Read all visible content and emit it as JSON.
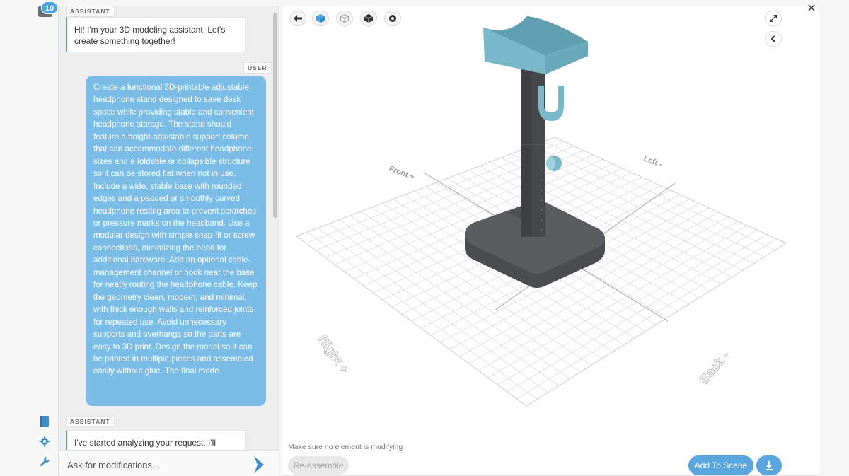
{
  "rail": {
    "badge_count": "10",
    "icons": [
      "chat-icon",
      "book-icon",
      "gear-icon",
      "wrench-icon"
    ]
  },
  "chat": {
    "messages": [
      {
        "role": "ASSISTANT",
        "text": "Hi! I'm your 3D modeling assistant. Let's create something together!"
      },
      {
        "role": "USER",
        "text": "Create a functional 3D-printable adjustable headphone stand designed to save desk space while providing stable and convenient headphone storage. The stand should feature a height-adjustable support column that can accommodate different headphone sizes and a foldable or collapsible structure so it can be stored flat when not in use. Include a wide, stable base with rounded edges and a padded or smoothly curved headphone resting area to prevent scratches or pressure marks on the headband. Use a modular design with simple snap-fit or screw connections, minimizing the need for additional hardware. Add an optional cable-management channel or hook near the base for neatly routing the headphone cable. Keep the geometry clean, modern, and minimal, with thick enough walls and reinforced joints for repeated use. Avoid unnecessary supports and overhangs so the parts are easy to 3D print. Design the model so it can be printed in multiple pieces and assembled easily without glue. The final mode"
      },
      {
        "role": "ASSISTANT",
        "text": "I've started analyzing your request. I'll follow"
      }
    ],
    "input_placeholder": "Ask for modifications..."
  },
  "viewer": {
    "toolbar": [
      "back-arrow-icon",
      "cube-solid-icon",
      "cube-wireframe-icon",
      "cube-shaded-icon",
      "gear-cube-icon"
    ],
    "axis_labels": {
      "front": "Front +",
      "left": "Left -",
      "right": "Right +",
      "back": "Back -"
    },
    "status_hint": "Make sure no element is modifying",
    "reassemble_label": "Re-assemble",
    "add_to_scene_label": "Add To Scene",
    "colors": {
      "accent": "#5aa7e0",
      "model_teal": "#79b8c8",
      "model_gray": "#4a4c4f"
    }
  }
}
